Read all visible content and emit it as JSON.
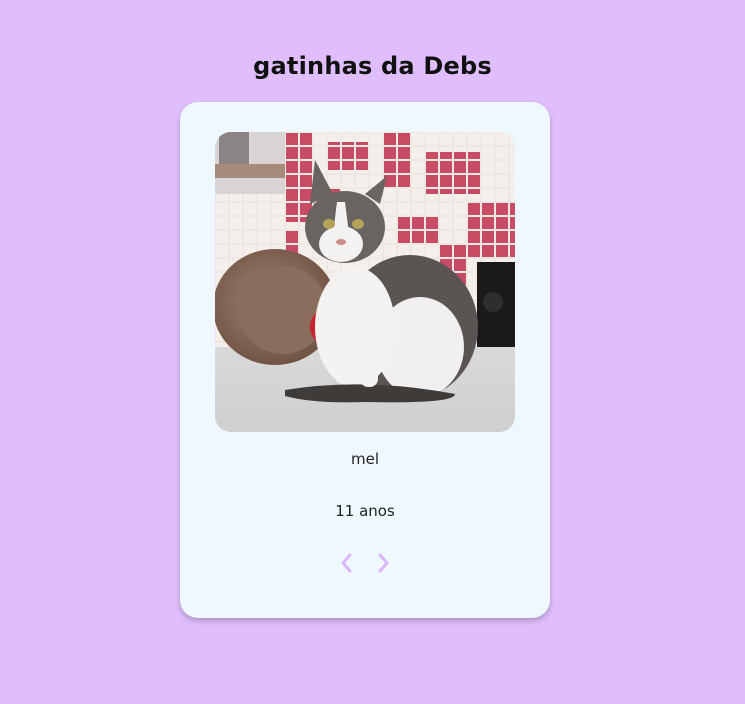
{
  "page": {
    "title": "gatinhas da Debs"
  },
  "card": {
    "name": "mel",
    "age": "11 anos",
    "photo_icon": "cat-photo",
    "prev_icon": "chevron-left-icon",
    "next_icon": "chevron-right-icon"
  },
  "colors": {
    "background": "#e0befd",
    "card": "#f0f8ff",
    "nav_arrow": "#dcb6fb"
  }
}
